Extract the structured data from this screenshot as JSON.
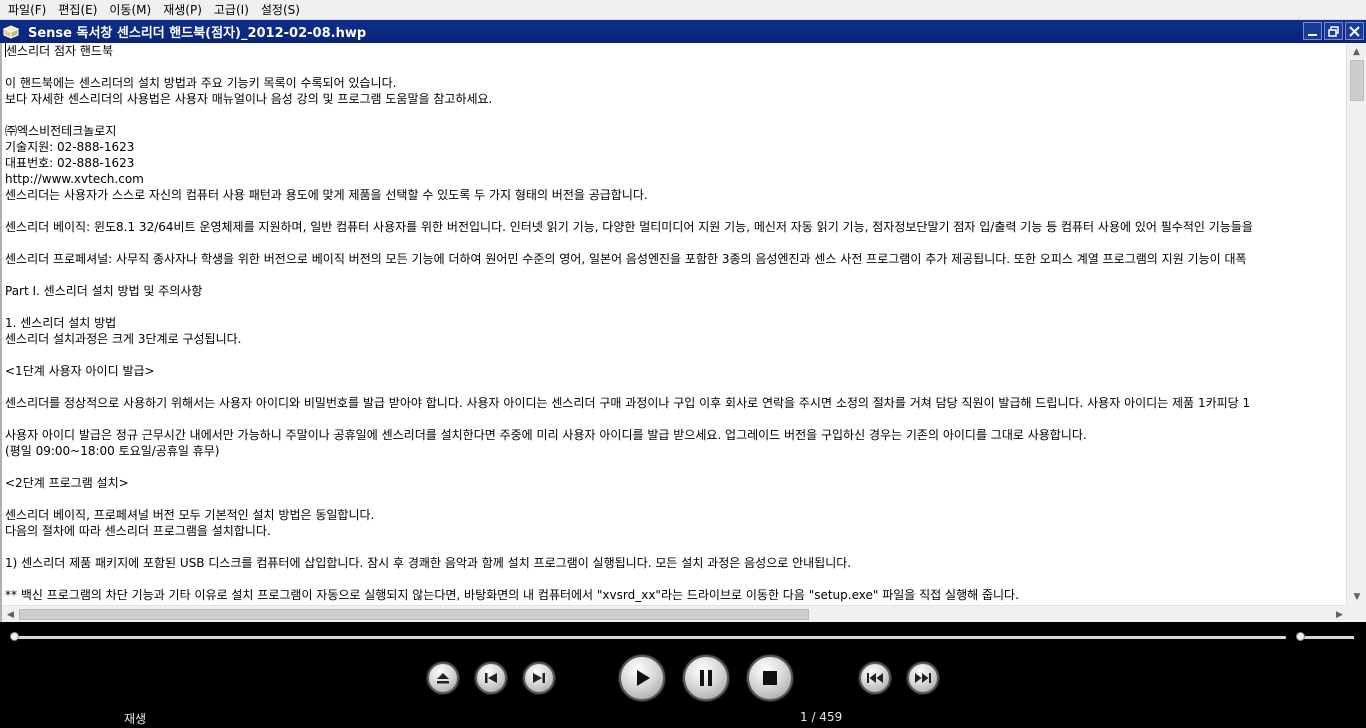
{
  "menu": {
    "items": [
      "파일(F)",
      "편집(E)",
      "이동(M)",
      "재생(P)",
      "고급(I)",
      "설정(S)"
    ]
  },
  "window": {
    "title": "Sense 독서창 센스리더 핸드북(점자)_2012-02-08.hwp",
    "icon": "document-icon"
  },
  "document": {
    "lines": [
      "센스리더 점자 핸드북",
      "",
      "이 핸드북에는 센스리더의 설치 방법과 주요 기능키 목록이 수록되어 있습니다.",
      "보다 자세한 센스리더의 사용법은 사용자 매뉴얼이나 음성 강의 및 프로그램 도움말을 참고하세요.",
      "",
      "㈜엑스비전테크놀로지",
      "기술지원: 02-888-1623",
      "대표번호: 02-888-1623",
      "http://www.xvtech.com",
      "센스리더는 사용자가 스스로 자신의 컴퓨터 사용 패턴과 용도에 맞게 제품을 선택할 수 있도록 두 가지 형태의 버전을 공급합니다.",
      "",
      "센스리더 베이직: 윈도8.1 32/64비트 운영체제를 지원하며, 일반 컴퓨터 사용자를 위한 버전입니다. 인터넷 읽기 기능, 다양한 멀티미디어 지원 기능, 메신저 자동 읽기 기능, 점자정보단말기 점자 입/출력 기능 등 컴퓨터 사용에 있어 필수적인 기능들을",
      "",
      "센스리더 프로페셔널: 사무직 종사자나 학생을 위한 버전으로 베이직 버전의 모든 기능에 더하여 원어민 수준의 영어, 일본어 음성엔진을 포함한 3종의 음성엔진과 센스 사전 프로그램이 추가 제공됩니다. 또한 오피스 계열 프로그램의 지원 기능이 대폭",
      "",
      "Part I. 센스리더 설치 방법 및 주의사항",
      "",
      "1. 센스리더 설치 방법",
      "센스리더 설치과정은 크게 3단계로 구성됩니다.",
      "",
      "<1단계 사용자 아이디 발급>",
      "",
      "센스리더를 정상적으로 사용하기 위해서는 사용자 아이디와 비밀번호를 발급 받아야 합니다. 사용자 아이디는 센스리더 구매 과정이나 구입 이후 회사로 연락을 주시면 소정의 절차를 거쳐 담당 직원이 발급해 드립니다. 사용자 아이디는 제품 1카피당 1",
      "",
      "사용자 아이디 발급은 정규 근무시간 내에서만 가능하니 주말이나 공휴일에 센스리더를 설치한다면 주중에 미리 사용자 아이디를 발급 받으세요. 업그레이드 버전을 구입하신 경우는 기존의 아이디를 그대로 사용합니다.",
      "(평일 09:00~18:00 토요일/공휴일 휴무)",
      "",
      "<2단계 프로그램 설치>",
      "",
      "센스리더 베이직, 프로페셔널 버전 모두 기본적인 설치 방법은 동일합니다.",
      "다음의 절차에 따라 센스리더 프로그램을 설치합니다.",
      "",
      "1) 센스리더 제품 패키지에 포함된 USB 디스크를 컴퓨터에 삽입합니다. 잠시 후 경쾌한 음악과 함께 설치 프로그램이 실행됩니다. 모든 설치 과정은 음성으로 안내됩니다.",
      "",
      "** 백신 프로그램의 차단 기능과 기타 이유로 설치 프로그램이 자동으로 실행되지 않는다면, 바탕화면의 내 컴퓨터에서 \"xvsrd_xx\"라는 드라이브로 이동한 다음 \"setup.exe\" 파일을 직접 실행해 줍니다."
    ]
  },
  "player": {
    "status_label": "재생",
    "page_indicator": "1 / 459",
    "seek_fraction": 0.0,
    "volume_fraction": 0.0,
    "buttons": [
      "eject-icon",
      "previous-icon",
      "next-icon",
      "play-icon",
      "pause-icon",
      "stop-icon",
      "rewind-icon",
      "fast-forward-icon"
    ]
  },
  "colors": {
    "titlebar": "#0e2f8c",
    "menubar": "#f0f0f0",
    "player_bg": "#000000"
  }
}
